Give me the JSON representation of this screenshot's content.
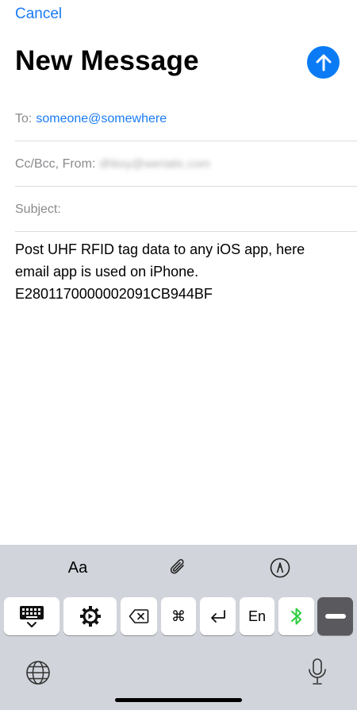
{
  "header": {
    "cancel_label": "Cancel",
    "title": "New Message",
    "send_icon": "arrow-up-icon"
  },
  "fields": {
    "to_label": "To:",
    "to_value": "someone@somewhere",
    "ccbcc_label": "Cc/Bcc, From:",
    "from_value": "dhboy@weriatic.com",
    "subject_label": "Subject:"
  },
  "body": {
    "text": "Post UHF RFID tag data to any iOS app, here email app is used on iPhone.\nE2801170000002091CB944BF"
  },
  "keyboard": {
    "toolbar": {
      "format_label": "Aa",
      "attach_icon": "paperclip-icon",
      "markup_icon": "markup-pen-icon"
    },
    "keys": {
      "hide_keyboard_icon": "keyboard-hide-icon",
      "settings_icon": "gear-icon",
      "delete_icon": "delete-backspace-icon",
      "command_label": "⌘",
      "return_icon": "return-icon",
      "language_label": "En",
      "bluetooth_icon": "bluetooth-icon",
      "minimize_icon": "minus-icon"
    },
    "globe_icon": "globe-icon",
    "mic_icon": "microphone-icon"
  },
  "colors": {
    "accent": "#1a7cf5",
    "send_button": "#0a7bf5",
    "keyboard_bg": "#d1d4da",
    "bluetooth": "#2ecc40"
  }
}
